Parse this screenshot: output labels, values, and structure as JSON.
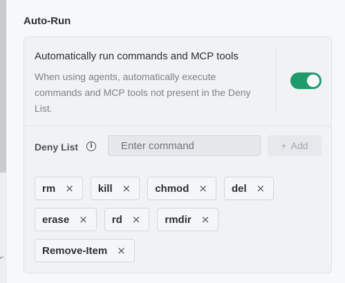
{
  "section": {
    "title": "Auto-Run"
  },
  "auto_run": {
    "title": "Automatically run commands and MCP tools",
    "description": "When using agents, automatically execute commands and MCP tools not present in the Deny List.",
    "enabled": true,
    "accent_color": "#1f9a6a"
  },
  "deny_list": {
    "label": "Deny List",
    "info_icon": "i",
    "input_placeholder": "Enter command",
    "add_label": "Add",
    "add_icon": "+",
    "remove_icon": "×",
    "rows": [
      [
        "rm",
        "kill",
        "chmod",
        "del"
      ],
      [
        "erase",
        "rd",
        "rmdir"
      ],
      [
        "Remove-Item"
      ]
    ]
  }
}
